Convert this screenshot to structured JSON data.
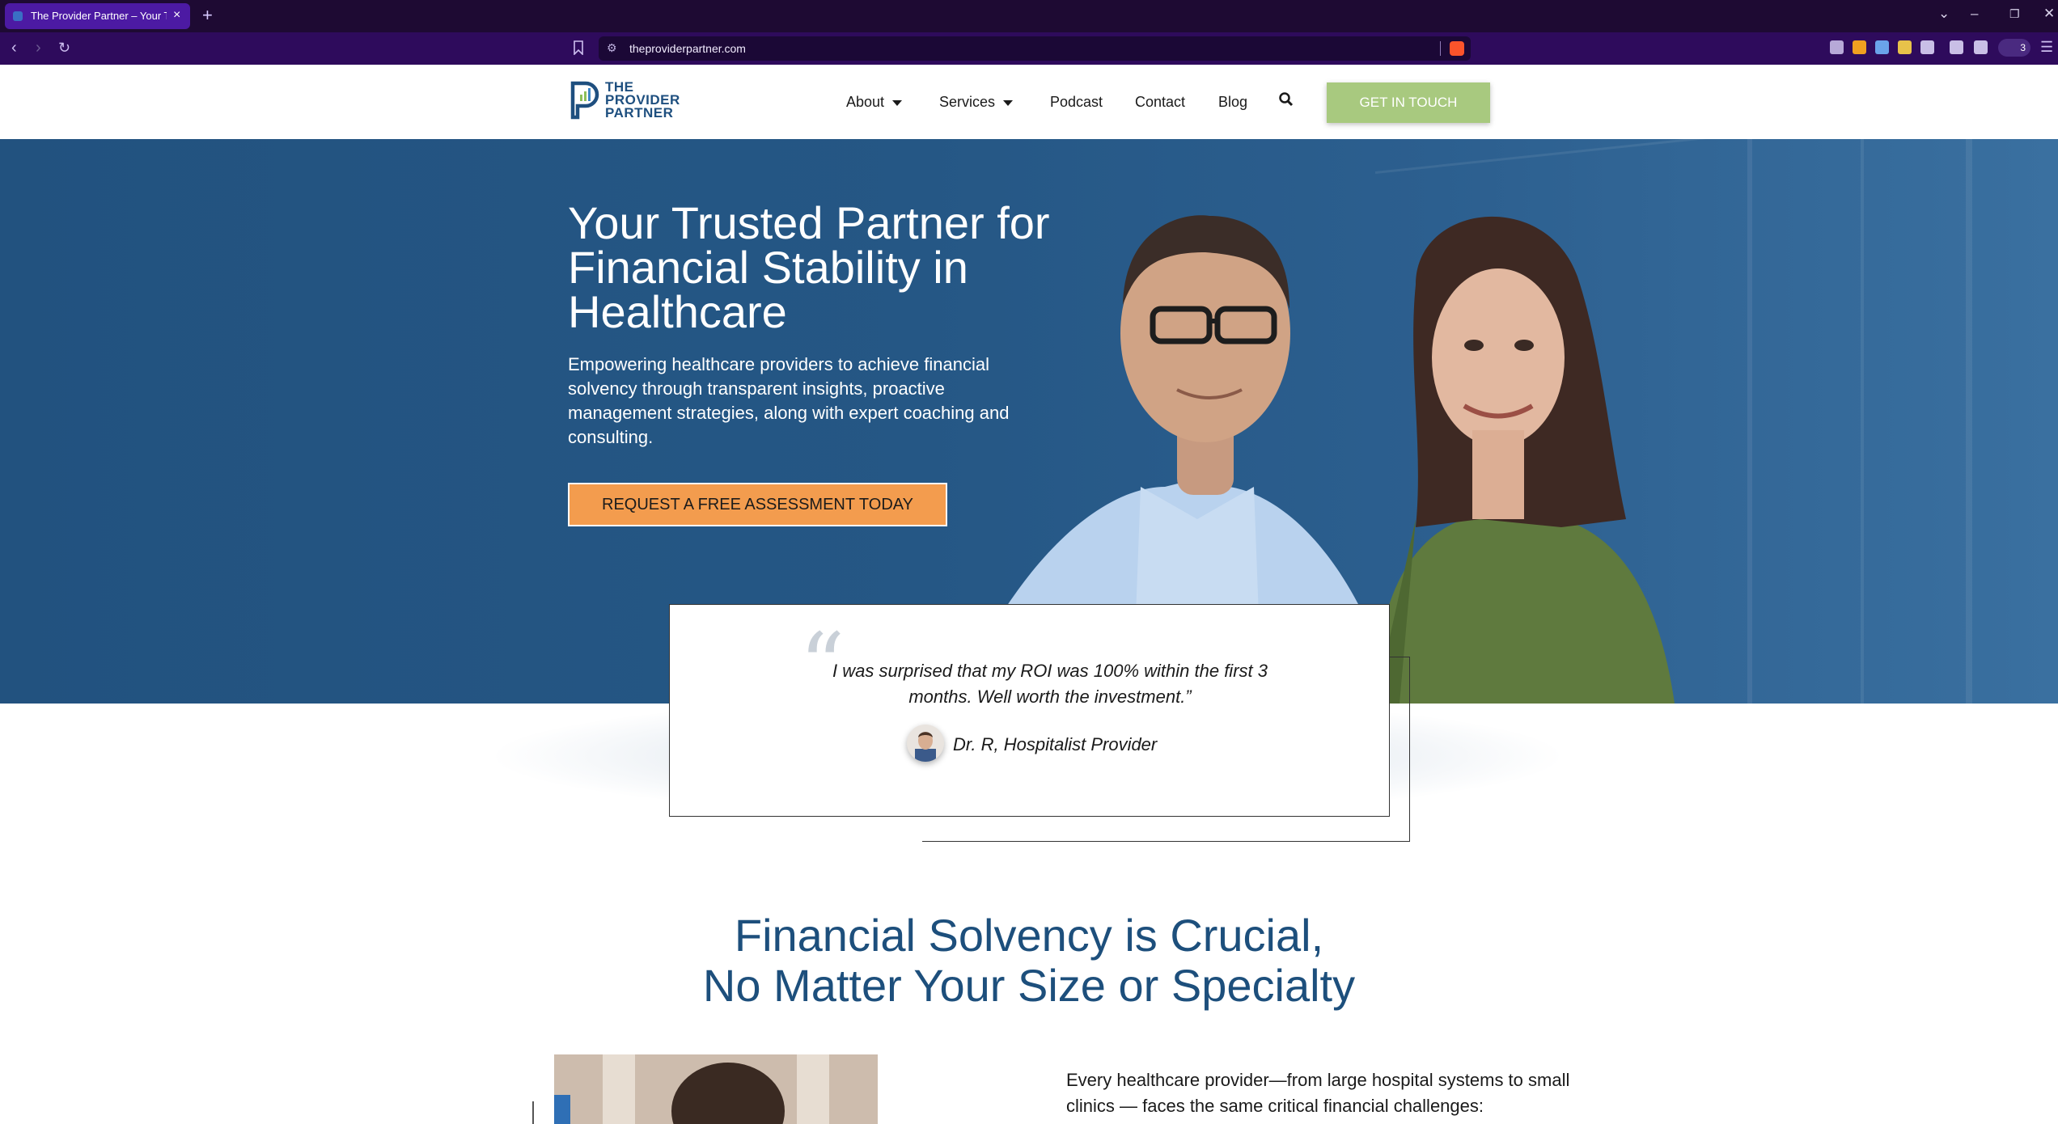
{
  "browser": {
    "tab_title": "The Provider Partner – Your Tru",
    "url": "theproviderpartner.com",
    "extensions_badge": "3"
  },
  "header": {
    "logo_line1": "THE",
    "logo_line2": "PROVIDER",
    "logo_line3": "PARTNER",
    "menu": {
      "about": "About",
      "services": "Services",
      "podcast": "Podcast",
      "contact": "Contact",
      "blog": "Blog"
    },
    "cta": "GET IN TOUCH"
  },
  "hero": {
    "title": "Your Trusted Partner for Financial Stability in Healthcare",
    "subtitle": "Empowering healthcare providers to achieve financial solvency through transparent insights, proactive management strategies, along with expert coaching and consulting.",
    "button": "REQUEST A FREE ASSESSMENT TODAY"
  },
  "testimonial": {
    "quote": "I was surprised that my ROI was 100% within the first 3 months. Well worth the investment.”",
    "author": "Dr. R, Hospitalist Provider"
  },
  "section": {
    "title_line1": "Financial Solvency is Crucial,",
    "title_line2": "No Matter Your Size or Specialty",
    "paragraph": "Every healthcare provider—from large hospital systems to small clinics — faces the same critical financial challenges:"
  },
  "colors": {
    "hero_blue": "#255785",
    "brand_navy": "#1e4f7f",
    "cta_green": "#a8c97f",
    "cta_orange": "#f39c4e",
    "browser_purple": "#2e0b5c"
  }
}
